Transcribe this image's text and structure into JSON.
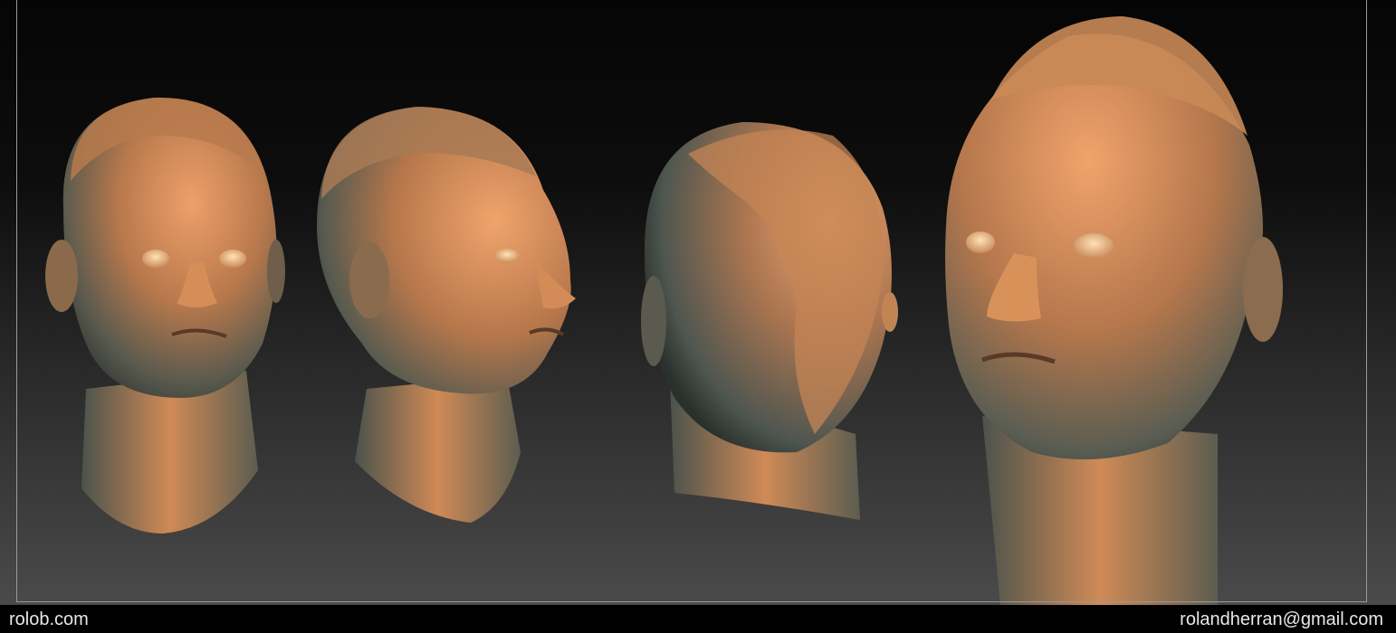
{
  "footer": {
    "site": "rolob.com",
    "email": "rolandherran@gmail.com"
  },
  "views": [
    {
      "name": "front-view"
    },
    {
      "name": "three-quarter-view"
    },
    {
      "name": "back-view"
    },
    {
      "name": "close-up-view"
    }
  ],
  "colors": {
    "skin_light": "#e8955a",
    "skin_mid": "#c07a4a",
    "skin_shadow": "#3d4540",
    "background_top": "#050505",
    "background_bottom": "#4a4a4a"
  }
}
